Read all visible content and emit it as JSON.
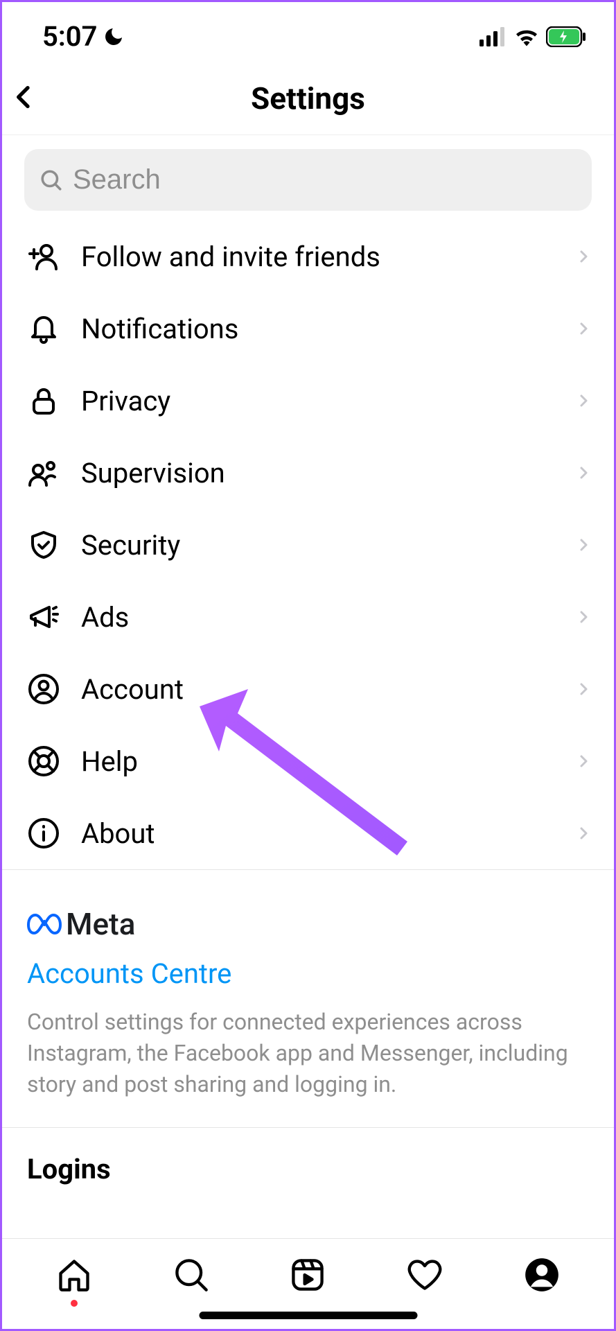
{
  "statusBar": {
    "time": "5:07"
  },
  "header": {
    "title": "Settings"
  },
  "search": {
    "placeholder": "Search"
  },
  "menu": {
    "items": [
      {
        "label": "Follow and invite friends"
      },
      {
        "label": "Notifications"
      },
      {
        "label": "Privacy"
      },
      {
        "label": "Supervision"
      },
      {
        "label": "Security"
      },
      {
        "label": "Ads"
      },
      {
        "label": "Account"
      },
      {
        "label": "Help"
      },
      {
        "label": "About"
      }
    ]
  },
  "meta": {
    "brand": "Meta",
    "link": "Accounts Centre",
    "description": "Control settings for connected experiences across Instagram, the Facebook app and Messenger, including story and post sharing and logging in."
  },
  "logins": {
    "title": "Logins"
  }
}
